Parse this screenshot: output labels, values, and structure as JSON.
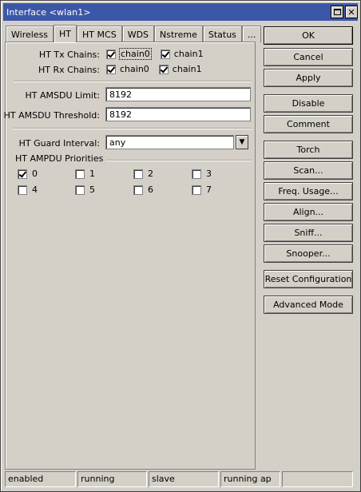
{
  "window": {
    "title": "Interface <wlan1>"
  },
  "tabs": [
    {
      "label": "Wireless"
    },
    {
      "label": "HT"
    },
    {
      "label": "HT MCS"
    },
    {
      "label": "WDS"
    },
    {
      "label": "Nstreme"
    },
    {
      "label": "Status"
    },
    {
      "label": "..."
    }
  ],
  "ht": {
    "tx_chains": {
      "label": "HT Tx Chains:",
      "chain0": "chain0",
      "chain1": "chain1",
      "chain0_checked": true,
      "chain1_checked": true
    },
    "rx_chains": {
      "label": "HT Rx Chains:",
      "chain0": "chain0",
      "chain1": "chain1",
      "chain0_checked": true,
      "chain1_checked": true
    },
    "amsdu_limit": {
      "label": "HT AMSDU Limit:",
      "value": "8192"
    },
    "amsdu_threshold": {
      "label": "HT AMSDU Threshold:",
      "value": "8192"
    },
    "guard_interval": {
      "label": "HT Guard Interval:",
      "value": "any"
    },
    "ampdu": {
      "title": "HT AMPDU Priorities",
      "priorities": [
        {
          "label": "0",
          "checked": true
        },
        {
          "label": "1",
          "checked": false
        },
        {
          "label": "2",
          "checked": false
        },
        {
          "label": "3",
          "checked": false
        },
        {
          "label": "4",
          "checked": false
        },
        {
          "label": "5",
          "checked": false
        },
        {
          "label": "6",
          "checked": false
        },
        {
          "label": "7",
          "checked": false
        }
      ]
    }
  },
  "buttons": {
    "ok": "OK",
    "cancel": "Cancel",
    "apply": "Apply",
    "disable": "Disable",
    "comment": "Comment",
    "torch": "Torch",
    "scan": "Scan...",
    "freq_usage": "Freq. Usage...",
    "align": "Align...",
    "sniff": "Sniff...",
    "snooper": "Snooper...",
    "reset_configuration": "Reset Configuration",
    "advanced_mode": "Advanced Mode"
  },
  "status": {
    "s1": "enabled",
    "s2": "running",
    "s3": "slave",
    "s4": "running ap",
    "s5": ""
  }
}
